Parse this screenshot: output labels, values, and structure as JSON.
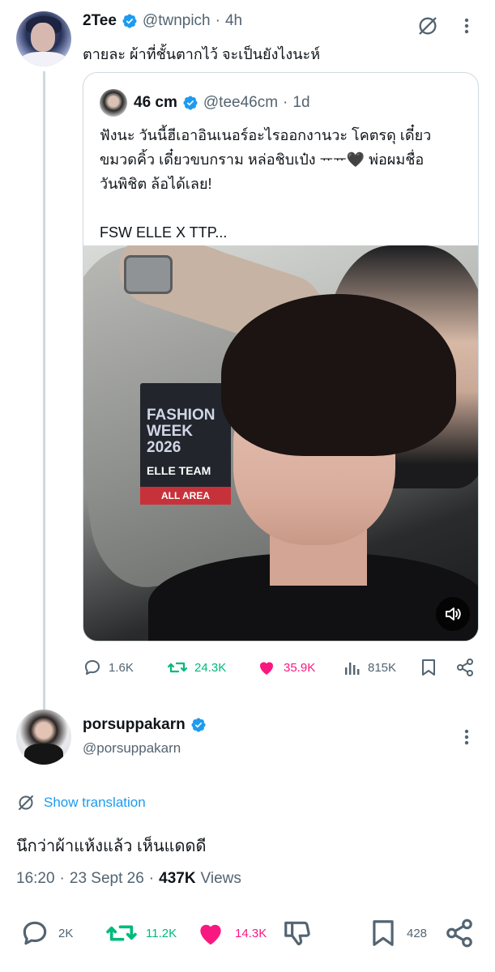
{
  "quoting_tweet": {
    "name": "2Tee",
    "handle": "@twnpich",
    "time": "4h",
    "text": "ตายละ ผ้าที่ชั้นตากไว้ จะเป็นยังไงนะห์",
    "quoted": {
      "name": "46 cm",
      "handle": "@tee46cm",
      "time": "1d",
      "text_line1": "ฟังนะ วันนี้ฮีเอาอินเนอร์อะไรออกงานวะ โคตรดุ เดี๋ยว",
      "text_line2": "ขมวดคิ้ว เดี๋ยวขบกราม หล่อชิบเป๋ง ᅲᅲ🖤 พ่อผมชื่อ",
      "text_line3": "วันพิชิต ล้อได้เลย!",
      "text_line4": "FSW ELLE X TTP...",
      "media": {
        "badge_title": "FASHION WEEK 2026",
        "badge_line1": "FASHION",
        "badge_line2": "WEEK",
        "badge_line3": "2026",
        "badge_team": "ELLE TEAM",
        "badge_area": "ALL AREA"
      }
    },
    "stats": {
      "replies": "1.6K",
      "reposts": "24.3K",
      "likes": "35.9K",
      "views": "815K"
    }
  },
  "main_tweet": {
    "name": "porsuppakarn",
    "handle": "@porsuppakarn",
    "translate_label": "Show translation",
    "text": "นึกว่าผ้าแห้งแล้ว เห็นแดดดี",
    "time": "16:20",
    "date": "23 Sept 26",
    "views_count": "437K",
    "views_label": "Views",
    "stats": {
      "replies": "2K",
      "reposts": "11.2K",
      "likes": "14.3K",
      "bookmarks": "428"
    }
  },
  "colors": {
    "verified": "#1d9bf0",
    "repost": "#00ba7c",
    "like": "#f91880",
    "link": "#1d9bf0",
    "secondary_text": "#536471"
  }
}
